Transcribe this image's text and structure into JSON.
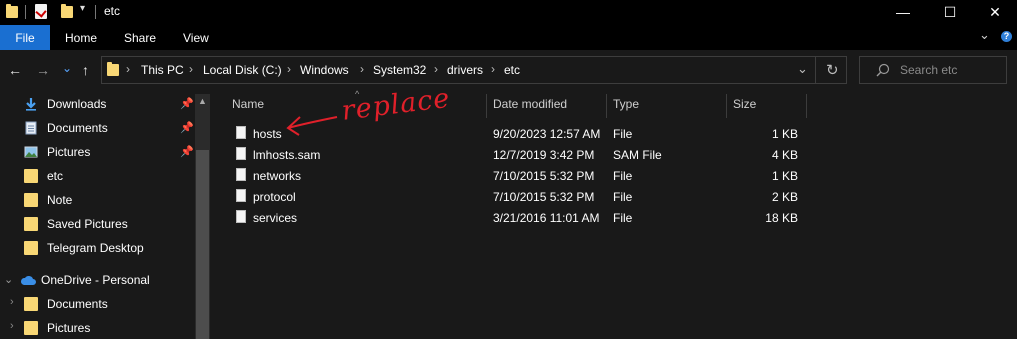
{
  "window": {
    "title": "etc",
    "minimize": "—",
    "maximize": "☐",
    "close": "✕"
  },
  "ribbon": {
    "tabs": [
      "File",
      "Home",
      "Share",
      "View"
    ],
    "expand": "⌄",
    "help": "?"
  },
  "nav": {
    "back": "←",
    "forward": "→",
    "recent": "⌄",
    "up": "↑",
    "dropdown": "⌄",
    "refresh": "↻"
  },
  "breadcrumb": [
    "This PC",
    "Local Disk (C:)",
    "Windows",
    "System32",
    "drivers",
    "etc"
  ],
  "search": {
    "placeholder": "Search etc"
  },
  "sidebar": {
    "items": [
      {
        "label": "Downloads",
        "icon": "download-icon",
        "pinned": true
      },
      {
        "label": "Documents",
        "icon": "documents-icon",
        "pinned": true
      },
      {
        "label": "Pictures",
        "icon": "pictures-icon",
        "pinned": true
      },
      {
        "label": "etc",
        "icon": "folder-icon",
        "pinned": false
      },
      {
        "label": "Note",
        "icon": "folder-icon",
        "pinned": false
      },
      {
        "label": "Saved Pictures",
        "icon": "folder-icon",
        "pinned": false
      },
      {
        "label": "Telegram Desktop",
        "icon": "folder-icon",
        "pinned": false
      }
    ],
    "onedrive": {
      "label": "OneDrive - Personal",
      "icon": "cloud-icon"
    },
    "onedrive_items": [
      {
        "label": "Documents",
        "icon": "folder-icon"
      },
      {
        "label": "Pictures",
        "icon": "folder-icon"
      }
    ]
  },
  "columns": [
    "Name",
    "Date modified",
    "Type",
    "Size"
  ],
  "files": [
    {
      "name": "hosts",
      "date": "9/20/2023 12:57 AM",
      "type": "File",
      "size": "1 KB"
    },
    {
      "name": "lmhosts.sam",
      "date": "12/7/2019 3:42 PM",
      "type": "SAM File",
      "size": "4 KB"
    },
    {
      "name": "networks",
      "date": "7/10/2015 5:32 PM",
      "type": "File",
      "size": "1 KB"
    },
    {
      "name": "protocol",
      "date": "7/10/2015 5:32 PM",
      "type": "File",
      "size": "2 KB"
    },
    {
      "name": "services",
      "date": "3/21/2016 11:01 AM",
      "type": "File",
      "size": "18 KB"
    }
  ],
  "annotation": {
    "text": "replace",
    "color": "#e0202a"
  },
  "colors": {
    "accent": "#1a6fd1",
    "folder": "#f8d775",
    "background": "#191919"
  }
}
